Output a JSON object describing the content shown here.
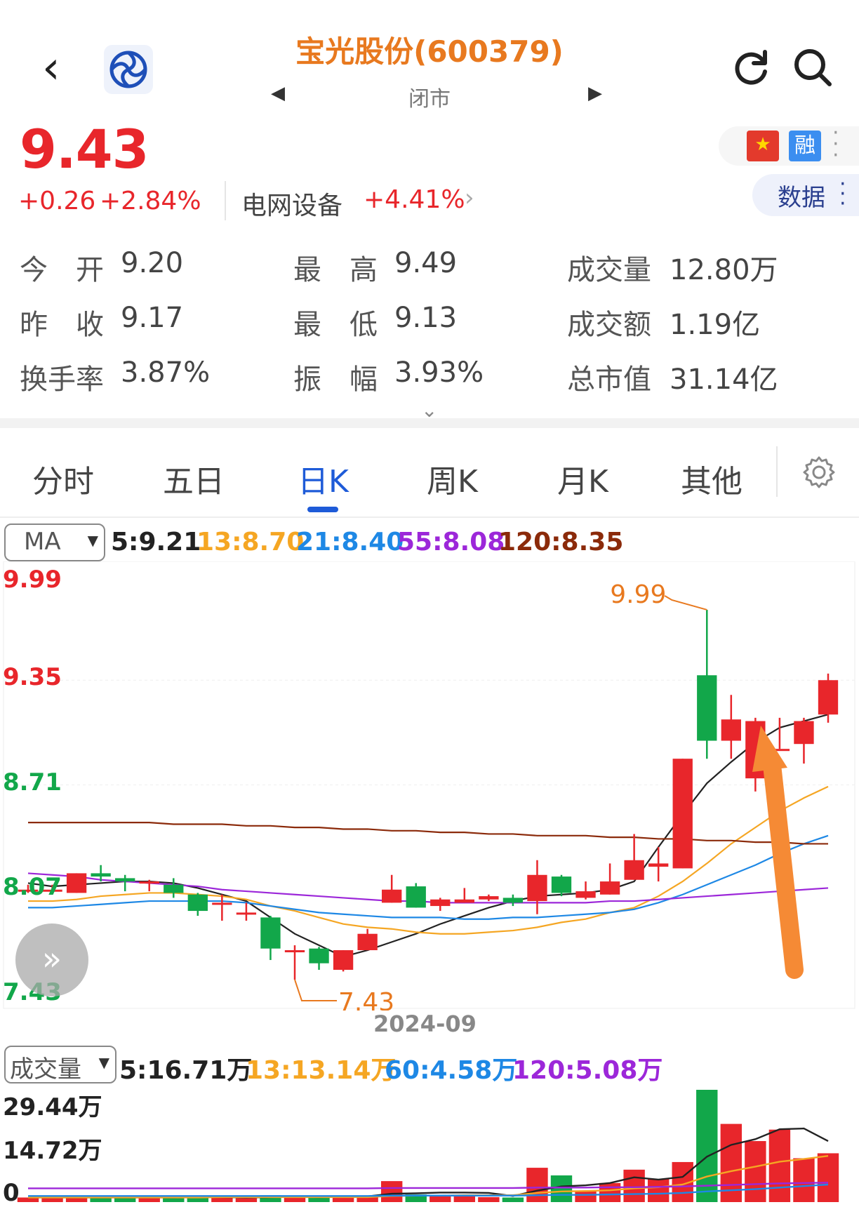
{
  "header": {
    "title": "宝光股份(600379)",
    "status": "闭市",
    "prev_glyph": "◀",
    "next_glyph": "▶",
    "back_glyph": "‹"
  },
  "quote": {
    "price": "9.43",
    "change": "+0.26",
    "change_pct": "+2.84%",
    "sector_name": "电网设备",
    "sector_pct": "+4.41%",
    "flag_glyph": "★",
    "rong_label": "融",
    "data_label": "数据",
    "expand_glyph": "⌄"
  },
  "stats": [
    {
      "label": "今　开",
      "value": "9.20"
    },
    {
      "label": "最　高",
      "value": "9.49"
    },
    {
      "label": "成交量",
      "value": "12.80万"
    },
    {
      "label": "昨　收",
      "value": "9.17"
    },
    {
      "label": "最　低",
      "value": "9.13"
    },
    {
      "label": "成交额",
      "value": "1.19亿"
    },
    {
      "label": "换手率",
      "value": "3.87%"
    },
    {
      "label": "振　幅",
      "value": "3.93%"
    },
    {
      "label": "总市值",
      "value": "31.14亿"
    }
  ],
  "tabs": [
    {
      "label": "分时"
    },
    {
      "label": "五日"
    },
    {
      "label": "日K",
      "active": true
    },
    {
      "label": "周K"
    },
    {
      "label": "月K"
    },
    {
      "label": "其他"
    }
  ],
  "ma_select": "MA",
  "ma_values": [
    {
      "text": "5:9.21",
      "color": "#222222"
    },
    {
      "text": "13:8.70",
      "color": "#f5a623"
    },
    {
      "text": "21:8.40",
      "color": "#1e88e5"
    },
    {
      "text": "55:8.08",
      "color": "#9c27d9"
    },
    {
      "text": "120:8.35",
      "color": "#8b2a0a"
    }
  ],
  "vol_select": "成交量",
  "vol_values": [
    {
      "text": "5:16.71万",
      "color": "#222222"
    },
    {
      "text": "13:13.14万",
      "color": "#f5a623"
    },
    {
      "text": "60:4.58万",
      "color": "#1e88e5"
    },
    {
      "text": "120:5.08万",
      "color": "#9c27d9"
    }
  ],
  "fast_forward_glyph": "»",
  "colors": {
    "up": "#e8262b",
    "down": "#12a74a",
    "accent": "#1e5bd8",
    "title": "#e8791f"
  },
  "chart_data": {
    "type": "candlestick",
    "date_label": "2024-09",
    "y_axis_labels": [
      {
        "text": "9.99",
        "color": "#e8262b"
      },
      {
        "text": "9.35",
        "color": "#e8262b"
      },
      {
        "text": "8.71",
        "color": "#12a74a"
      },
      {
        "text": "8.07",
        "color": "#12a74a"
      },
      {
        "text": "7.43",
        "color": "#12a74a"
      }
    ],
    "ylim": [
      7.43,
      9.99
    ],
    "annotations": {
      "high": "9.99",
      "low": "7.43"
    },
    "candles": [
      {
        "o": 8.07,
        "c": 8.07,
        "h": 8.1,
        "l": 8.05
      },
      {
        "o": 8.07,
        "c": 8.07,
        "h": 8.1,
        "l": 8.05
      },
      {
        "o": 8.05,
        "c": 8.17,
        "h": 8.17,
        "l": 8.05
      },
      {
        "o": 8.17,
        "c": 8.15,
        "h": 8.22,
        "l": 8.12
      },
      {
        "o": 8.14,
        "c": 8.12,
        "h": 8.16,
        "l": 8.06
      },
      {
        "o": 8.12,
        "c": 8.12,
        "h": 8.13,
        "l": 8.06
      },
      {
        "o": 8.1,
        "c": 8.05,
        "h": 8.14,
        "l": 8.02
      },
      {
        "o": 8.04,
        "c": 7.94,
        "h": 8.05,
        "l": 7.91
      },
      {
        "o": 7.99,
        "c": 7.99,
        "h": 8.04,
        "l": 7.88
      },
      {
        "o": 7.93,
        "c": 7.93,
        "h": 7.99,
        "l": 7.88
      },
      {
        "o": 7.9,
        "c": 7.71,
        "h": 7.91,
        "l": 7.64
      },
      {
        "o": 7.7,
        "c": 7.7,
        "h": 7.73,
        "l": 7.52
      },
      {
        "o": 7.71,
        "c": 7.62,
        "h": 7.72,
        "l": 7.58
      },
      {
        "o": 7.58,
        "c": 7.7,
        "h": 7.7,
        "l": 7.57
      },
      {
        "o": 7.7,
        "c": 7.8,
        "h": 7.83,
        "l": 7.7
      },
      {
        "o": 7.99,
        "c": 8.07,
        "h": 8.16,
        "l": 7.99
      },
      {
        "o": 8.09,
        "c": 7.96,
        "h": 8.11,
        "l": 7.96
      },
      {
        "o": 7.97,
        "c": 8.01,
        "h": 8.02,
        "l": 7.94
      },
      {
        "o": 7.99,
        "c": 8.01,
        "h": 8.08,
        "l": 7.99
      },
      {
        "o": 8.01,
        "c": 8.03,
        "h": 8.04,
        "l": 8.0
      },
      {
        "o": 8.02,
        "c": 7.99,
        "h": 8.04,
        "l": 7.97
      },
      {
        "o": 8.0,
        "c": 8.16,
        "h": 8.25,
        "l": 7.92
      },
      {
        "o": 8.15,
        "c": 8.05,
        "h": 8.16,
        "l": 8.03
      },
      {
        "o": 8.02,
        "c": 8.06,
        "h": 8.12,
        "l": 8.01
      },
      {
        "o": 8.04,
        "c": 8.12,
        "h": 8.23,
        "l": 8.04
      },
      {
        "o": 8.13,
        "c": 8.25,
        "h": 8.41,
        "l": 8.13
      },
      {
        "o": 8.21,
        "c": 8.23,
        "h": 8.33,
        "l": 8.12
      },
      {
        "o": 8.2,
        "c": 8.87,
        "h": 8.87,
        "l": 8.2
      },
      {
        "o": 9.38,
        "c": 8.98,
        "h": 9.78,
        "l": 8.87
      },
      {
        "o": 8.98,
        "c": 9.11,
        "h": 9.26,
        "l": 8.87
      },
      {
        "o": 8.75,
        "c": 9.1,
        "h": 9.12,
        "l": 8.67
      },
      {
        "o": 8.93,
        "c": 8.93,
        "h": 9.12,
        "l": 8.93
      },
      {
        "o": 8.96,
        "c": 9.1,
        "h": 9.12,
        "l": 8.84
      },
      {
        "o": 9.14,
        "c": 9.35,
        "h": 9.39,
        "l": 9.09
      }
    ],
    "ma_series": [
      {
        "name": "5",
        "color": "#222222",
        "values": [
          8.11,
          8.09,
          8.1,
          8.11,
          8.12,
          8.12,
          8.11,
          8.08,
          8.04,
          8.0,
          7.9,
          7.8,
          7.73,
          7.66,
          7.7,
          7.75,
          7.8,
          7.86,
          7.91,
          7.96,
          8.0,
          8.03,
          8.04,
          8.05,
          8.07,
          8.12,
          8.33,
          8.53,
          8.72,
          8.85,
          8.97,
          9.06,
          9.1,
          9.14
        ]
      },
      {
        "name": "13",
        "color": "#f5a623",
        "values": [
          8.0,
          8.0,
          8.01,
          8.03,
          8.04,
          8.05,
          8.05,
          8.04,
          8.03,
          8.01,
          7.97,
          7.94,
          7.9,
          7.86,
          7.84,
          7.83,
          7.81,
          7.8,
          7.8,
          7.81,
          7.82,
          7.84,
          7.87,
          7.89,
          7.93,
          7.96,
          8.03,
          8.12,
          8.23,
          8.35,
          8.45,
          8.55,
          8.63,
          8.7
        ]
      },
      {
        "name": "21",
        "color": "#1e88e5",
        "values": [
          7.96,
          7.96,
          7.97,
          7.98,
          7.99,
          8.0,
          8.0,
          8.0,
          8.0,
          7.99,
          7.97,
          7.95,
          7.93,
          7.92,
          7.91,
          7.9,
          7.9,
          7.9,
          7.89,
          7.89,
          7.9,
          7.9,
          7.91,
          7.92,
          7.93,
          7.95,
          7.99,
          8.04,
          8.1,
          8.16,
          8.22,
          8.29,
          8.35,
          8.4
        ]
      },
      {
        "name": "55",
        "color": "#9c27d9",
        "values": [
          8.17,
          8.16,
          8.15,
          8.13,
          8.12,
          8.11,
          8.1,
          8.09,
          8.07,
          8.06,
          8.05,
          8.04,
          8.03,
          8.02,
          8.01,
          8.0,
          8.0,
          7.99,
          7.99,
          7.99,
          7.99,
          7.99,
          7.99,
          7.99,
          8.0,
          8.0,
          8.01,
          8.02,
          8.03,
          8.04,
          8.05,
          8.06,
          8.07,
          8.08
        ]
      },
      {
        "name": "120",
        "color": "#8b2a0a",
        "values": [
          8.48,
          8.48,
          8.48,
          8.48,
          8.48,
          8.48,
          8.47,
          8.47,
          8.47,
          8.46,
          8.46,
          8.45,
          8.45,
          8.44,
          8.44,
          8.43,
          8.43,
          8.42,
          8.42,
          8.41,
          8.41,
          8.4,
          8.4,
          8.4,
          8.39,
          8.39,
          8.38,
          8.38,
          8.37,
          8.37,
          8.36,
          8.36,
          8.35,
          8.35
        ]
      }
    ]
  },
  "volume_data": {
    "type": "bar",
    "y_axis_labels": [
      "29.44万",
      "14.72万",
      "0"
    ],
    "ylim": [
      0,
      29.44
    ],
    "values": [
      1.2,
      1.0,
      1.5,
      1.3,
      1.1,
      1.0,
      1.2,
      1.5,
      1.2,
      1.0,
      1.8,
      1.4,
      1.2,
      1.4,
      1.6,
      5.5,
      2.0,
      1.7,
      1.6,
      1.3,
      1.2,
      9.0,
      7.0,
      3.0,
      5.0,
      8.5,
      6.0,
      10.5,
      29.44,
      20.5,
      16.0,
      19.0,
      11.5,
      12.8
    ],
    "ma_series": [
      {
        "name": "5",
        "color": "#222222",
        "values": [
          1.2,
          1.2,
          1.2,
          1.2,
          1.2,
          1.2,
          1.2,
          1.3,
          1.3,
          1.2,
          1.3,
          1.4,
          1.3,
          1.4,
          1.5,
          2.2,
          2.3,
          2.5,
          2.5,
          2.4,
          1.6,
          3.0,
          4.1,
          4.4,
          5.0,
          6.5,
          5.9,
          6.6,
          11.9,
          15.0,
          16.5,
          19.1,
          19.3,
          16.0
        ]
      },
      {
        "name": "13",
        "color": "#f5a623",
        "values": [
          1.2,
          1.2,
          1.2,
          1.2,
          1.2,
          1.2,
          1.2,
          1.2,
          1.3,
          1.3,
          1.3,
          1.3,
          1.3,
          1.3,
          1.3,
          1.6,
          1.7,
          1.7,
          1.8,
          1.8,
          1.8,
          2.4,
          2.8,
          2.9,
          3.1,
          3.6,
          3.9,
          4.6,
          6.7,
          8.1,
          9.3,
          10.6,
          11.3,
          12.1
        ]
      },
      {
        "name": "60",
        "color": "#1e88e5",
        "values": [
          1.6,
          1.6,
          1.6,
          1.6,
          1.6,
          1.6,
          1.6,
          1.6,
          1.6,
          1.6,
          1.6,
          1.6,
          1.6,
          1.6,
          1.6,
          1.7,
          1.7,
          1.7,
          1.7,
          1.7,
          1.7,
          1.8,
          1.9,
          1.9,
          2.0,
          2.1,
          2.2,
          2.4,
          2.8,
          3.1,
          3.4,
          3.8,
          4.2,
          4.6
        ]
      },
      {
        "name": "120",
        "color": "#9c27d9",
        "values": [
          3.6,
          3.6,
          3.6,
          3.6,
          3.6,
          3.6,
          3.6,
          3.6,
          3.6,
          3.6,
          3.6,
          3.6,
          3.6,
          3.6,
          3.6,
          3.7,
          3.7,
          3.7,
          3.7,
          3.7,
          3.7,
          3.8,
          3.8,
          3.8,
          3.9,
          3.9,
          4.0,
          4.1,
          4.3,
          4.5,
          4.7,
          4.9,
          5.0,
          5.1
        ]
      }
    ]
  }
}
